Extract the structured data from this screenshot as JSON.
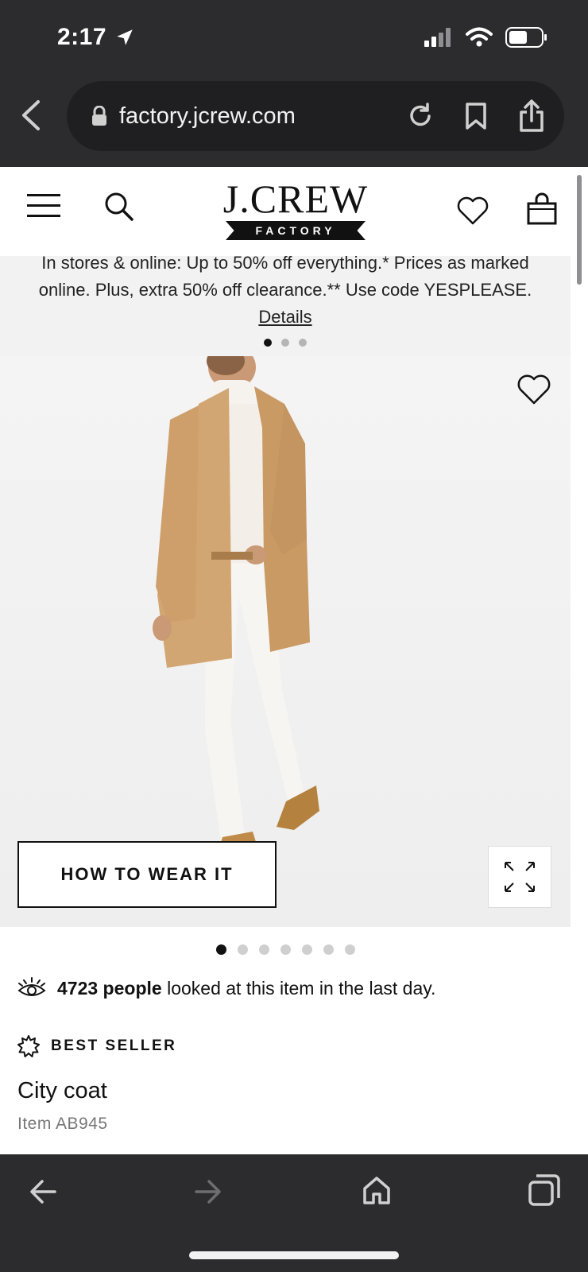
{
  "status_bar": {
    "time": "2:17"
  },
  "browser": {
    "url": "factory.jcrew.com"
  },
  "header": {
    "logo_main": "J.CREW",
    "logo_sub": "FACTORY"
  },
  "promo": {
    "line1": "In stores & online: Up to 50% off everything.* Prices as marked",
    "line2": "online. Plus, extra 50% off clearance.** Use code YESPLEASE.",
    "details_link": "Details"
  },
  "product": {
    "how_to_wear_label": "HOW TO WEAR IT",
    "viewers_count": "4723 people",
    "viewers_text": "looked at this item in the last day.",
    "badge": "BEST SELLER",
    "name": "City coat",
    "item_code": "Item AB945"
  },
  "colors": {
    "chrome": "#2c2c2e",
    "coat": "#d2a673",
    "promo_bg": "#f2f2f2"
  }
}
